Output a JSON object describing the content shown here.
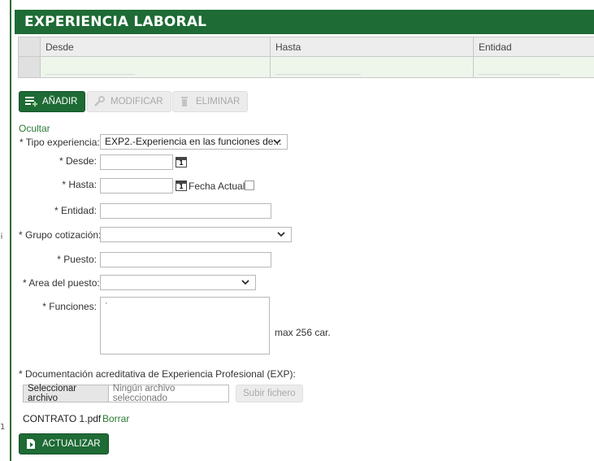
{
  "margin_marks": [
    "¡",
    "1"
  ],
  "section": {
    "title": "EXPERIENCIA LABORAL"
  },
  "grid": {
    "columns": [
      "Desde",
      "Hasta",
      "Entidad"
    ]
  },
  "toolbar": {
    "add_label": "AÑADIR",
    "modify_label": "MODIFICAR",
    "delete_label": "ELIMINAR"
  },
  "form": {
    "toggle_link": "Ocultar",
    "tipo_label": "* Tipo experiencia:",
    "tipo_value": "EXP2.-Experiencia en las funciones de...",
    "desde_label": "* Desde:",
    "hasta_label": "* Hasta:",
    "calendar_day": "1",
    "fecha_actual_label": "Fecha Actual:",
    "entidad_label": "* Entidad:",
    "grupo_label": "* Grupo cotización:",
    "puesto_label": "* Puesto:",
    "area_label": "* Area del puesto:",
    "funciones_label": "* Funciones:",
    "funciones_value": "·",
    "max_chars": "max 256 car."
  },
  "documentation": {
    "label": "* Documentación acreditativa de Experiencia Profesional (EXP):",
    "select_file_button": "Seleccionar archivo",
    "no_file_text": "Ningún archivo seleccionado",
    "upload_button": "Subir fichero",
    "attached_file": "CONTRATO 1.pdf",
    "delete_link": "Borrar"
  },
  "footer": {
    "update_label": "ACTUALIZAR"
  },
  "colors": {
    "primary": "#1e6b35",
    "link": "#2a7a33",
    "row_bg": "#eef6ec"
  }
}
